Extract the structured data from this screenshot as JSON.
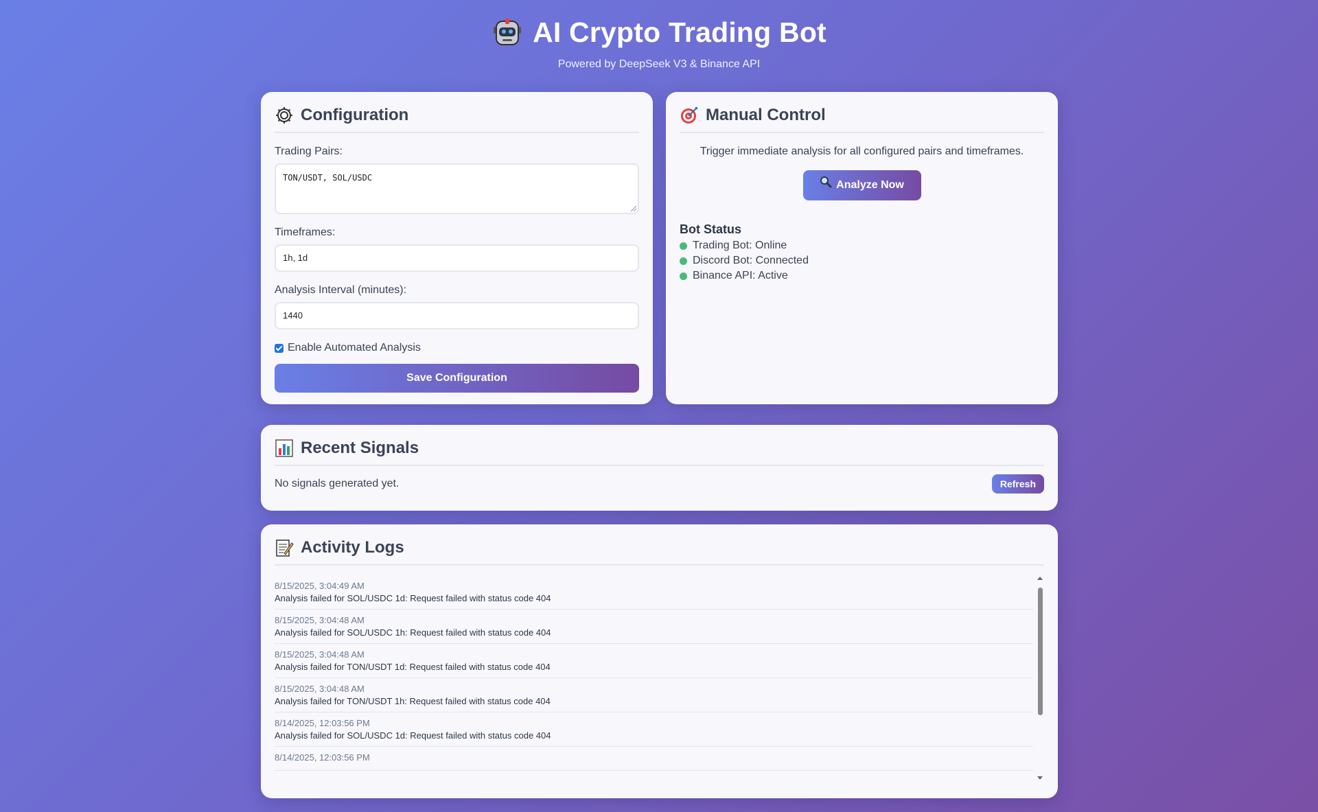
{
  "header": {
    "title": "AI Crypto Trading Bot",
    "subtitle": "Powered by DeepSeek V3 & Binance API"
  },
  "config": {
    "title": "Configuration",
    "icon": "gear-icon",
    "pairs_label": "Trading Pairs:",
    "pairs_value": "TON/USDT, SOL/USDC",
    "timeframes_label": "Timeframes:",
    "timeframes_value": "1h, 1d",
    "interval_label": "Analysis Interval (minutes):",
    "interval_value": "1440",
    "auto_label": "Enable Automated Analysis",
    "auto_checked": true,
    "save_label": "Save Configuration"
  },
  "manual": {
    "title": "Manual Control",
    "icon": "target-icon",
    "description": "Trigger immediate analysis for all configured pairs and timeframes.",
    "analyze_label": "Analyze Now",
    "status_title": "Bot Status",
    "status_items": [
      {
        "label": "Trading Bot: Online",
        "color": "#48bb78"
      },
      {
        "label": "Discord Bot: Connected",
        "color": "#48bb78"
      },
      {
        "label": "Binance API: Active",
        "color": "#48bb78"
      }
    ]
  },
  "signals": {
    "title": "Recent Signals",
    "icon": "bar-chart-icon",
    "empty_text": "No signals generated yet.",
    "refresh_label": "Refresh"
  },
  "logs": {
    "title": "Activity Logs",
    "icon": "memo-icon",
    "items": [
      {
        "time": "8/15/2025, 3:04:49 AM",
        "message": "Analysis failed for SOL/USDC 1d: Request failed with status code 404"
      },
      {
        "time": "8/15/2025, 3:04:48 AM",
        "message": "Analysis failed for SOL/USDC 1h: Request failed with status code 404"
      },
      {
        "time": "8/15/2025, 3:04:48 AM",
        "message": "Analysis failed for TON/USDT 1d: Request failed with status code 404"
      },
      {
        "time": "8/15/2025, 3:04:48 AM",
        "message": "Analysis failed for TON/USDT 1h: Request failed with status code 404"
      },
      {
        "time": "8/14/2025, 12:03:56 PM",
        "message": "Analysis failed for SOL/USDC 1d: Request failed with status code 404"
      },
      {
        "time": "8/14/2025, 12:03:56 PM",
        "message": ""
      }
    ]
  },
  "colors": {
    "accent_start": "#6a7fe6",
    "accent_end": "#764ba2",
    "status_green": "#48bb78"
  }
}
